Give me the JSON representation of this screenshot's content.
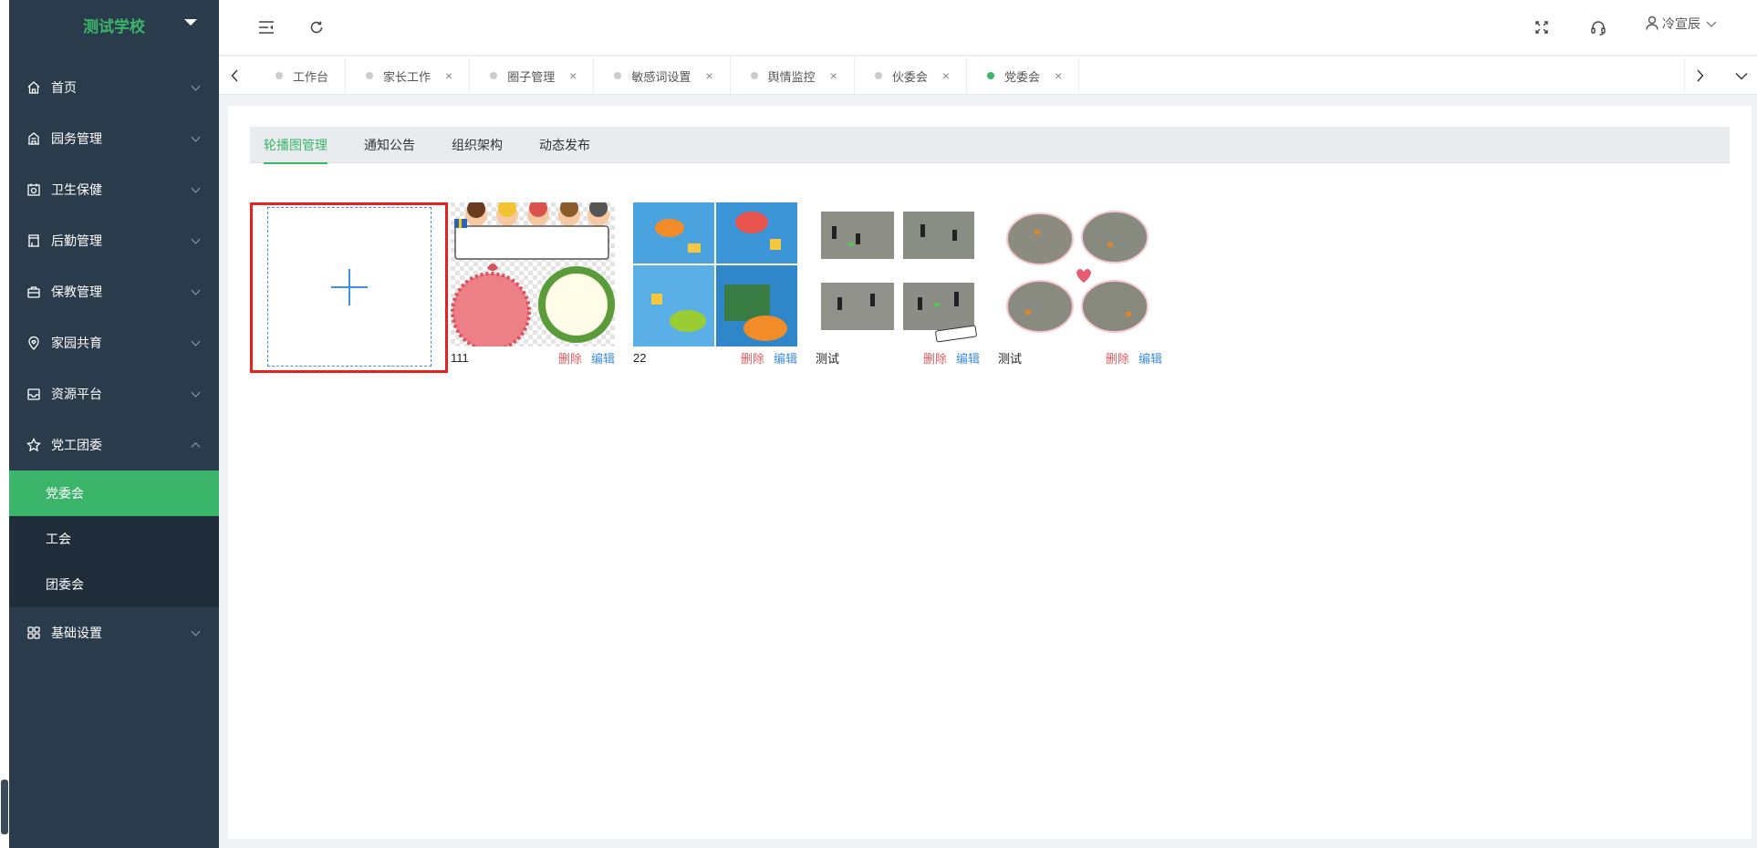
{
  "sidebar": {
    "school_name": "测试学校",
    "menu": [
      {
        "label": "首页",
        "icon": "home-icon"
      },
      {
        "label": "园务管理",
        "icon": "building-icon"
      },
      {
        "label": "卫生保健",
        "icon": "health-icon"
      },
      {
        "label": "后勤管理",
        "icon": "logistics-icon"
      },
      {
        "label": "保教管理",
        "icon": "briefcase-icon"
      },
      {
        "label": "家园共育",
        "icon": "location-heart-icon"
      },
      {
        "label": "资源平台",
        "icon": "inbox-icon"
      },
      {
        "label": "党工团委",
        "icon": "star-icon"
      }
    ],
    "submenu": [
      {
        "label": "党委会",
        "active": true
      },
      {
        "label": "工会",
        "active": false
      },
      {
        "label": "团委会",
        "active": false
      }
    ],
    "settings": {
      "label": "基础设置",
      "icon": "grid-icon"
    }
  },
  "header": {
    "user_name": "冷宣辰"
  },
  "tabs": [
    {
      "label": "工作台",
      "closable": false,
      "active": false
    },
    {
      "label": "家长工作",
      "closable": true,
      "active": false
    },
    {
      "label": "圈子管理",
      "closable": true,
      "active": false
    },
    {
      "label": "敏感词设置",
      "closable": true,
      "active": false
    },
    {
      "label": "舆情监控",
      "closable": true,
      "active": false
    },
    {
      "label": "伙委会",
      "closable": true,
      "active": false
    },
    {
      "label": "党委会",
      "closable": true,
      "active": true
    }
  ],
  "subtabs": [
    {
      "label": "轮播图管理",
      "active": true
    },
    {
      "label": "通知公告",
      "active": false
    },
    {
      "label": "组织架构",
      "active": false
    },
    {
      "label": "动态发布",
      "active": false
    }
  ],
  "cards": [
    {
      "title": "111",
      "delete_label": "删除",
      "edit_label": "编辑",
      "image": "cartoon-kids-frame"
    },
    {
      "title": "22",
      "delete_label": "删除",
      "edit_label": "编辑",
      "image": "colorful-collage"
    },
    {
      "title": "测试",
      "delete_label": "删除",
      "edit_label": "编辑",
      "image": "playground-photos-grid"
    },
    {
      "title": "测试",
      "delete_label": "删除",
      "edit_label": "编辑",
      "image": "playground-photos-hearts"
    }
  ],
  "colors": {
    "sidebar_bg": "#2a3b4c",
    "accent": "#3bb56a",
    "delete": "#f25a5a",
    "edit": "#3f8fe6",
    "upload_border": "#e8211e"
  }
}
